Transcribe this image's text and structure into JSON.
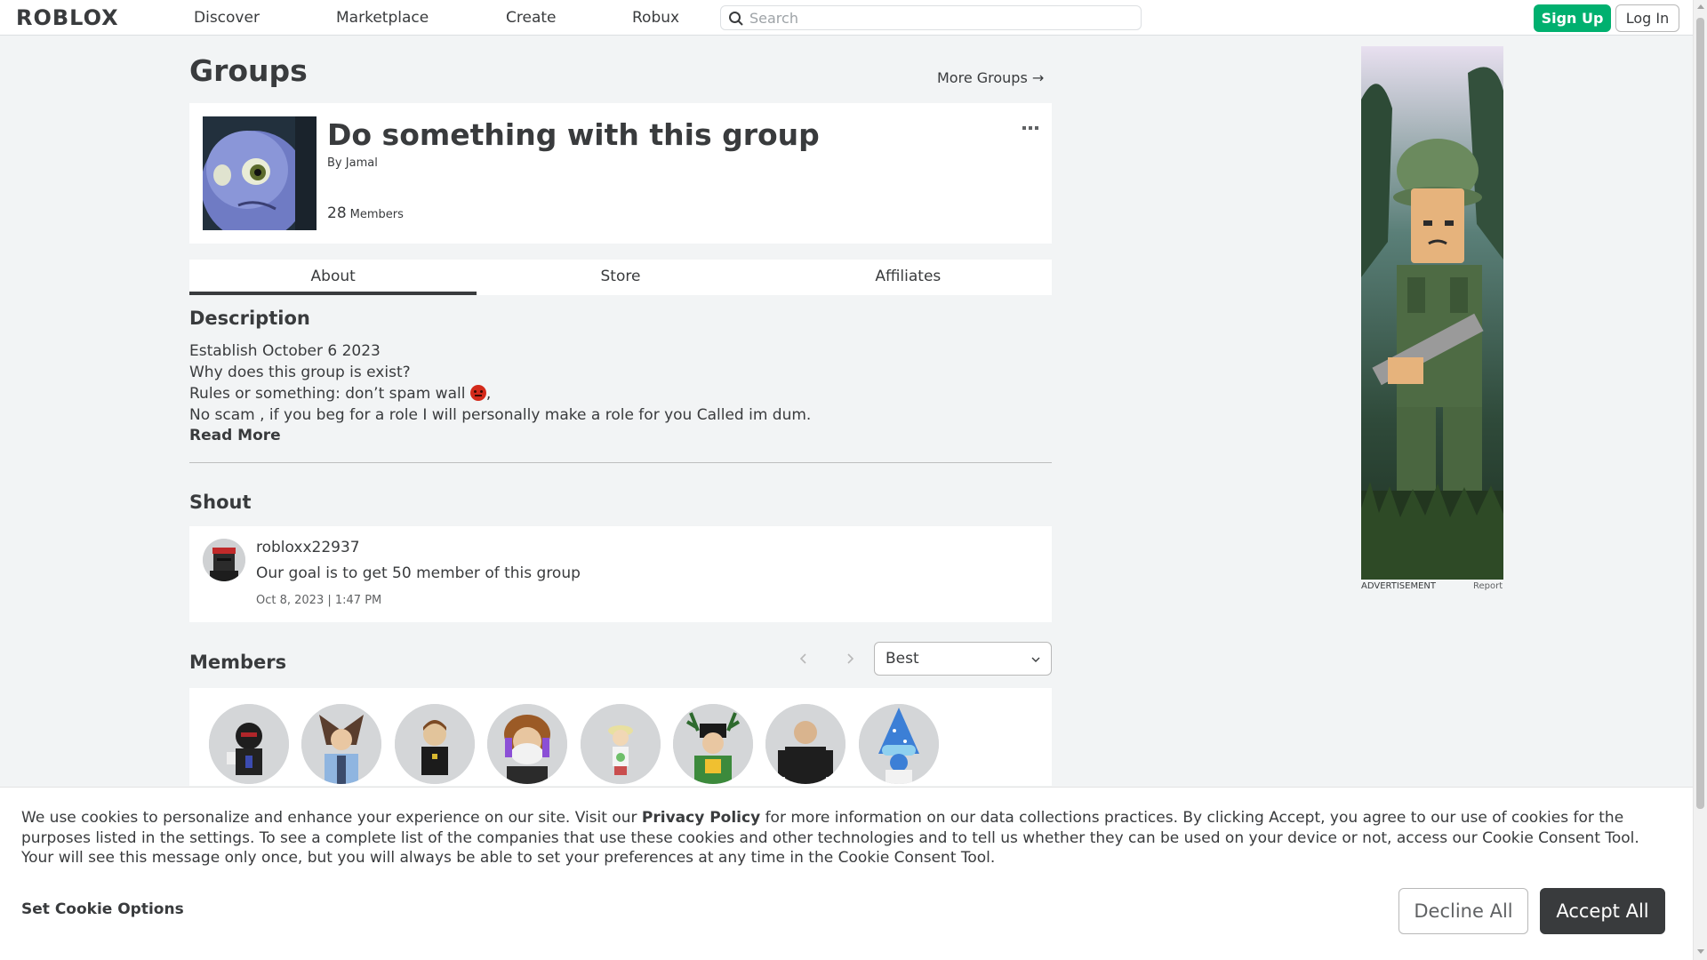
{
  "header": {
    "logo": "ROBLOX",
    "nav": [
      "Discover",
      "Marketplace",
      "Create",
      "Robux"
    ],
    "search_placeholder": "Search",
    "signup_label": "Sign Up",
    "login_label": "Log In"
  },
  "page": {
    "title": "Groups",
    "more_groups": "More Groups →"
  },
  "group": {
    "name": "Do something with this group",
    "by_label": "By",
    "owner": "Jamal",
    "member_count": "28",
    "member_label": "Members",
    "menu_icon": "ellipsis-icon"
  },
  "tabs": [
    "About",
    "Store",
    "Affiliates"
  ],
  "active_tab": "About",
  "description": {
    "heading": "Description",
    "lines": [
      "Establish October 6 2023",
      "Why does this group is exist?",
      "Rules or something: don’t spam wall",
      "No scam , if you beg for a role I will personally make a role for you Called im dum."
    ],
    "line3_suffix": ",",
    "read_more": "Read More"
  },
  "shout": {
    "heading": "Shout",
    "user": "robloxx22937",
    "text": "Our goal is to get 50 member of this group",
    "date": "Oct 8, 2023 | 1:47 PM"
  },
  "members": {
    "heading": "Members",
    "sort_value": "Best",
    "avatar_count": 8
  },
  "ad": {
    "label": "ADVERTISEMENT",
    "report": "Report"
  },
  "cookie": {
    "text_before": "We use cookies to personalize and enhance your experience on our site. Visit our ",
    "privacy_link": "Privacy Policy",
    "text_after": " for more information on our data collections practices. By clicking Accept, you agree to our use of cookies for the purposes listed in the settings. To see a complete list of the companies that use these cookies and other technologies and to tell us whether they can be used on your device or not, access our Cookie Consent Tool. Your will see this message only once, but you will always be able to set your preferences at any time in the Cookie Consent Tool.",
    "options_label": "Set Cookie Options",
    "decline_label": "Decline All",
    "accept_label": "Accept All"
  },
  "colors": {
    "background": "#f2f4f5",
    "signup_green": "#00b06f",
    "text": "#393b3d",
    "accept_dark": "#393b3d"
  }
}
